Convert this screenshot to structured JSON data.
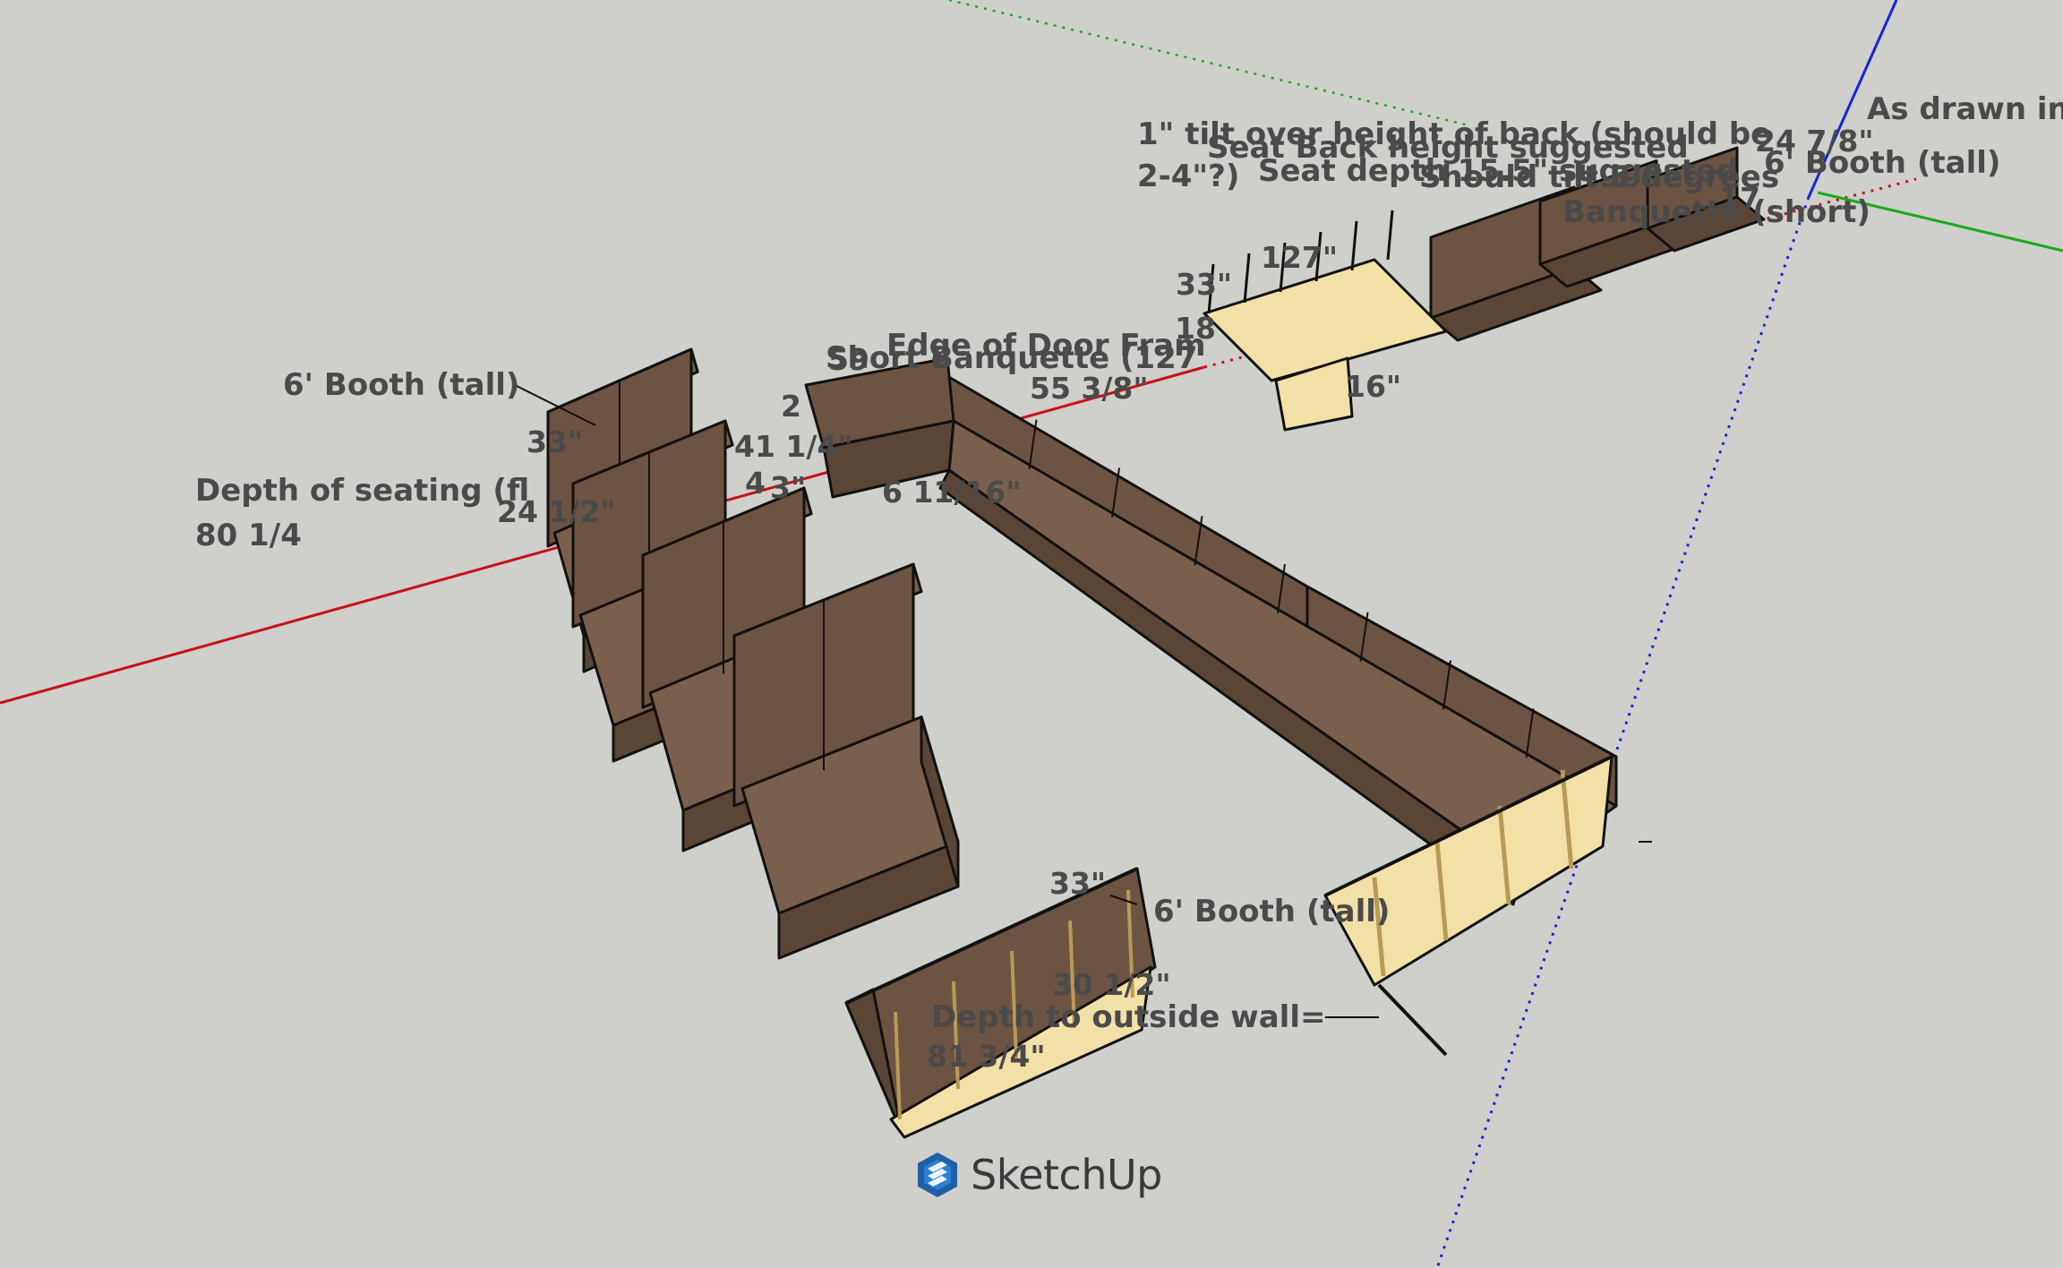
{
  "app": {
    "name": "SketchUp",
    "logo_text": "SketchUp",
    "background": "#cfcfcb"
  },
  "colors": {
    "axis_red": "#c8101a",
    "axis_green": "#1aaa1a",
    "axis_blue": "#1526d6",
    "wood_dark": "#5b4636",
    "wood_face": "#6d5442",
    "wood_top": "#7a604c",
    "edge": "#111111",
    "frame_light": "#f3e0a6",
    "text": "#4a4a4a"
  },
  "annotations": {
    "as_drawn": "As drawn in",
    "tilt_note_line1": "1\" tilt over height of back (should be",
    "tilt_note_line2": "2-4\"?)",
    "seat_back_height": "Seat Back height suggested",
    "seat_depth": "Seat depth 15.5\" suggested",
    "should_tilt": "Should tilt 5 degrees",
    "booth_tall_top_right": "6' Booth (tall)",
    "banquette_short": "Banquette (short)",
    "dim_24_7_8": "24 7/8\"",
    "dim_17": "17",
    "dim_127": "127\"",
    "dim_33_top": "33\"",
    "dim_16": "16\"",
    "dim_18": "18",
    "edge_door_frame": "Edge of Door Fram",
    "short_banquette": "Short Banquette (127",
    "dim_55_3_8": "55 3/8\"",
    "dim_41_1_4": "41 1/4\"",
    "dim_6_11_16": "6 11/16\"",
    "dim_59": "59",
    "booth_tall_left": "6' Booth (tall)",
    "depth_seating_line1": "Depth of seating (fl",
    "depth_seating_line2": "80 1/4",
    "dim_33_left": "33\"",
    "dim_24_1_2": "24 1/2\"",
    "dim_33_bottom": "33\"",
    "booth_tall_bottom": "6' Booth (tall)",
    "dim_30_1_2": "30 1/2\"",
    "depth_outside_wall": "Depth to outside wall=",
    "dim_81_3_4": "81 3/4\"",
    "dim_3": "3\"",
    "dim_4": "4",
    "dim_2": "2"
  }
}
